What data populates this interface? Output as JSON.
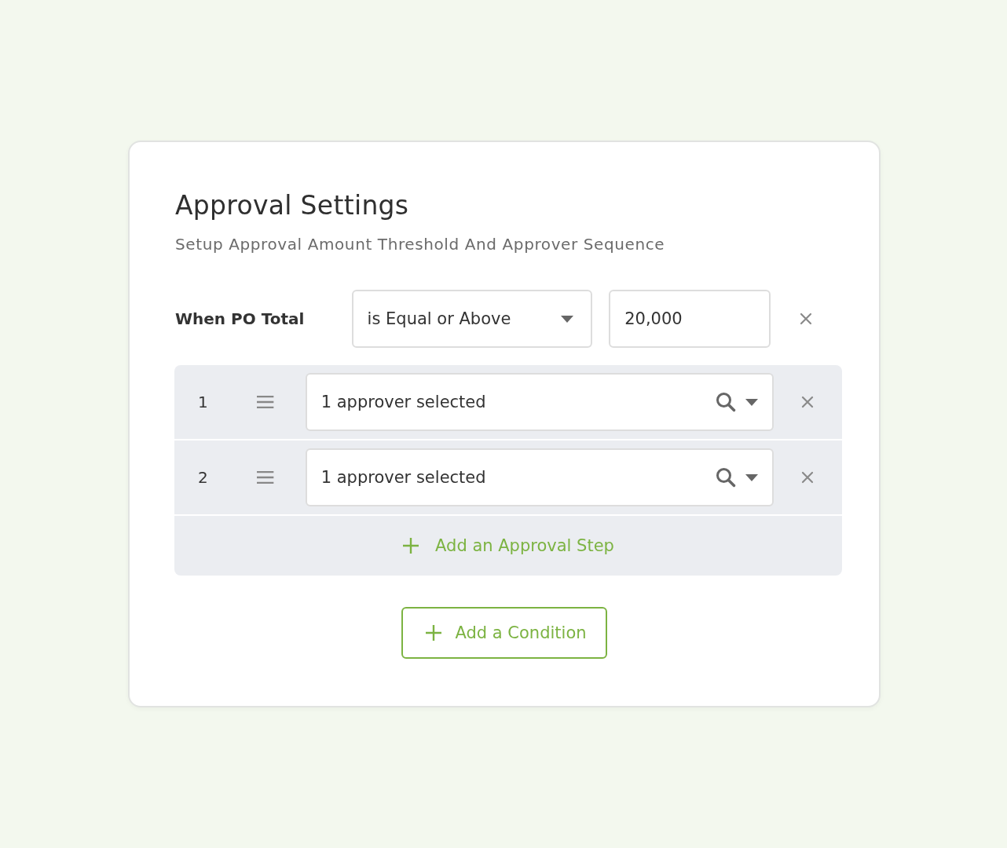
{
  "header": {
    "title": "Approval Settings",
    "subtitle": "Setup Approval Amount Threshold And Approver Sequence"
  },
  "condition": {
    "label": "When PO Total",
    "operator": "is Equal or Above",
    "amount": "20,000"
  },
  "steps": [
    {
      "number": "1",
      "value": "1 approver selected"
    },
    {
      "number": "2",
      "value": "1 approver selected"
    }
  ],
  "add_step": {
    "label": "Add an Approval Step"
  },
  "add_condition": {
    "label": "Add a Condition"
  }
}
